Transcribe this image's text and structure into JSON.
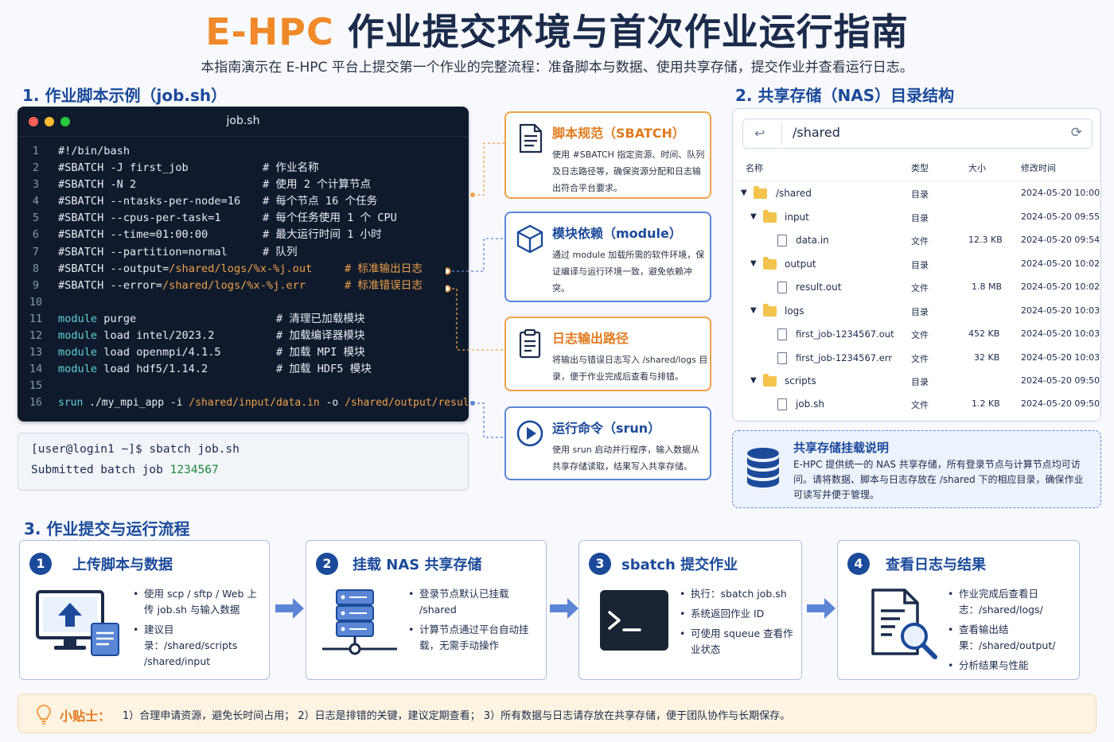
{
  "header": {
    "title_accent": "E-HPC",
    "title_rest": " 作业提交环境与首次作业运行指南",
    "subtitle": "本指南演示在 E-HPC 平台上提交第一个作业的完整流程：准备脚本与数据、使用共享存储，提交作业并查看运行日志。"
  },
  "sections": {
    "s1": "1. 作业脚本示例（job.sh）",
    "s2": "2. 共享存储（NAS）目录结构",
    "s3": "3. 作业提交与运行流程"
  },
  "code": {
    "filename": "job.sh",
    "lines": [
      {
        "n": "1",
        "code": "#!/bin/bash",
        "comment": ""
      },
      {
        "n": "2",
        "code": "#SBATCH -J first_job",
        "comment": "# 作业名称"
      },
      {
        "n": "3",
        "code": "#SBATCH -N 2",
        "comment": "# 使用 2 个计算节点"
      },
      {
        "n": "4",
        "code": "#SBATCH --ntasks-per-node=16",
        "comment": "# 每个节点 16 个任务"
      },
      {
        "n": "5",
        "code": "#SBATCH --cpus-per-task=1",
        "comment": "# 每个任务使用 1 个 CPU"
      },
      {
        "n": "6",
        "code": "#SBATCH --time=01:00:00",
        "comment": "# 最大运行时间 1 小时"
      },
      {
        "n": "7",
        "code": "#SBATCH --partition=normal",
        "comment": "# 队列"
      },
      {
        "n": "8",
        "code_a": "#SBATCH --output=",
        "code_b": "/shared/logs/%x-%j.out",
        "comment": "# 标准输出日志"
      },
      {
        "n": "9",
        "code_a": "#SBATCH --error=",
        "code_b": "/shared/logs/%x-%j.err",
        "comment": "# 标准错误日志"
      },
      {
        "n": "10",
        "code": "",
        "comment": ""
      },
      {
        "n": "11",
        "code_a": "module",
        "code_b": " purge",
        "comment": "# 清理已加载模块"
      },
      {
        "n": "12",
        "code_a": "module",
        "code_b": " load intel/2023.2",
        "comment": "# 加载编译器模块"
      },
      {
        "n": "13",
        "code_a": "module",
        "code_b": " load openmpi/4.1.5",
        "comment": "# 加载 MPI 模块"
      },
      {
        "n": "14",
        "code_a": "module",
        "code_b": " load hdf5/1.14.2",
        "comment": "# 加载 HDF5 模块"
      },
      {
        "n": "15",
        "code": "",
        "comment": ""
      },
      {
        "n": "16",
        "srun": "srun",
        "app": " ./my_mpi_app -i ",
        "input": "/shared/input/data.in",
        "o": " -o ",
        "output": "/shared/output/result.out"
      }
    ]
  },
  "terminal": {
    "line1": "[user@login1 ~]$ sbatch job.sh",
    "line2_a": "Submitted batch job ",
    "line2_b": "1234567"
  },
  "callouts": [
    {
      "title": "脚本规范（SBATCH）",
      "desc": "使用 #SBATCH 指定资源、时间、队列及日志路径等，确保资源分配和日志输出符合平台要求。"
    },
    {
      "title": "模块依赖（module）",
      "desc": "通过 module 加载所需的软件环境，保证编译与运行环境一致，避免依赖冲突。"
    },
    {
      "title": "日志输出路径",
      "desc": "将输出与错误日志写入 /shared/logs 目录，便于作业完成后查看与排错。"
    },
    {
      "title": "运行命令（srun）",
      "desc": "使用 srun 启动并行程序，输入数据从共享存储读取，结果写入共享存储。"
    }
  ],
  "nas": {
    "path": "/shared",
    "columns": [
      "名称",
      "类型",
      "大小",
      "修改时间"
    ],
    "rows": [
      {
        "name": "/shared",
        "type": "目录",
        "size": "",
        "time": "2024-05-20 10:00"
      },
      {
        "name": "input",
        "type": "目录",
        "size": "",
        "time": "2024-05-20 09:55"
      },
      {
        "name": "data.in",
        "type": "文件",
        "size": "12.3 KB",
        "time": "2024-05-20 09:54"
      },
      {
        "name": "output",
        "type": "目录",
        "size": "",
        "time": "2024-05-20 10:02"
      },
      {
        "name": "result.out",
        "type": "文件",
        "size": "1.8 MB",
        "time": "2024-05-20 10:02"
      },
      {
        "name": "logs",
        "type": "目录",
        "size": "",
        "time": "2024-05-20 10:03"
      },
      {
        "name": "first_job-1234567.out",
        "type": "文件",
        "size": "452 KB",
        "time": "2024-05-20 10:03"
      },
      {
        "name": "first_job-1234567.err",
        "type": "文件",
        "size": "32 KB",
        "time": "2024-05-20 10:03"
      },
      {
        "name": "scripts",
        "type": "目录",
        "size": "",
        "time": "2024-05-20 09:50"
      },
      {
        "name": "job.sh",
        "type": "文件",
        "size": "1.2 KB",
        "time": "2024-05-20 09:50"
      }
    ],
    "note_title": "共享存储挂载说明",
    "note_text": "E-HPC 提供统一的 NAS 共享存储，所有登录节点与计算节点均可访问。请将数据、脚本与日志存放在 /shared 下的相应目录，确保作业可读写并便于管理。"
  },
  "steps": [
    {
      "num": "1",
      "title": "上传脚本与数据",
      "items": [
        "使用 scp / sftp / Web 上传 job.sh 与输入数据",
        "建议目录：/shared/scripts /shared/input"
      ]
    },
    {
      "num": "2",
      "title": "挂载 NAS 共享存储",
      "items": [
        "登录节点默认已挂载 /shared",
        "计算节点通过平台自动挂载，无需手动操作"
      ]
    },
    {
      "num": "3",
      "title": "sbatch 提交作业",
      "items": [
        "执行：sbatch job.sh",
        "系统返回作业 ID",
        "可使用 squeue 查看作业状态"
      ]
    },
    {
      "num": "4",
      "title": "查看日志与结果",
      "items": [
        "作业完成后查看日志：/shared/logs/",
        "查看输出结果：/shared/output/",
        "分析结果与性能"
      ]
    }
  ],
  "tip": {
    "label": "小贴士：",
    "text": "1）合理申请资源，避免长时间占用；  2）日志是排错的关键，建议定期查看；  3）所有数据与日志请存放在共享存储，便于团队协作与长期保存。"
  },
  "colors": {
    "accent_orange": "#f0892a",
    "primary_blue": "#1b4a9a",
    "code_bg": "#0f1b2c"
  }
}
